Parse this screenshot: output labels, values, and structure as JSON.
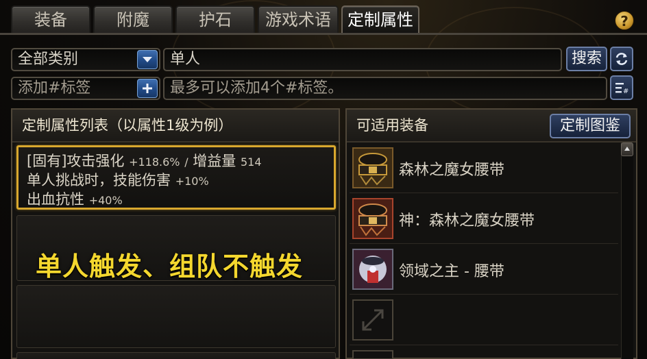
{
  "tabs": [
    {
      "label": "装备"
    },
    {
      "label": "附魔"
    },
    {
      "label": "护石"
    },
    {
      "label": "游戏术语"
    },
    {
      "label": "定制属性"
    }
  ],
  "help_label": "?",
  "search": {
    "category_value": "全部类别",
    "query_value": "单人",
    "search_button": "搜索",
    "tag_placeholder": "添加#标签",
    "tag_hint": "最多可以添加4个#标签。"
  },
  "left_panel": {
    "title": "定制属性列表（以属性1级为例）",
    "selected_card": {
      "line1_main": "[固有]攻击强化",
      "line1_value": "+118.6%",
      "line1_sep": "/",
      "line1_extra": "增益量",
      "line1_extra_value": "514",
      "line2_main": "单人挑战时，技能伤害",
      "line2_value": "+10%",
      "line3_main": "出血抗性",
      "line3_value": "+40%"
    },
    "overlay_caption": "单人触发、组队不触发"
  },
  "right_panel": {
    "title": "可适用装备",
    "guide_button": "定制图鉴",
    "items": [
      {
        "name": "森林之魔女腰带",
        "icon": "belt-icon"
      },
      {
        "name": "神：森林之魔女腰带",
        "icon": "belt-icon"
      },
      {
        "name": "领域之主 - 腰带",
        "icon": "belt-icon"
      },
      {
        "name": "",
        "icon": "empty-slot-icon"
      },
      {
        "name": "",
        "icon": "empty-slot-icon"
      }
    ]
  },
  "colors": {
    "accent_gold": "#d9a82e",
    "caption_yellow": "#f4d72e",
    "button_blue": "#214a86"
  }
}
